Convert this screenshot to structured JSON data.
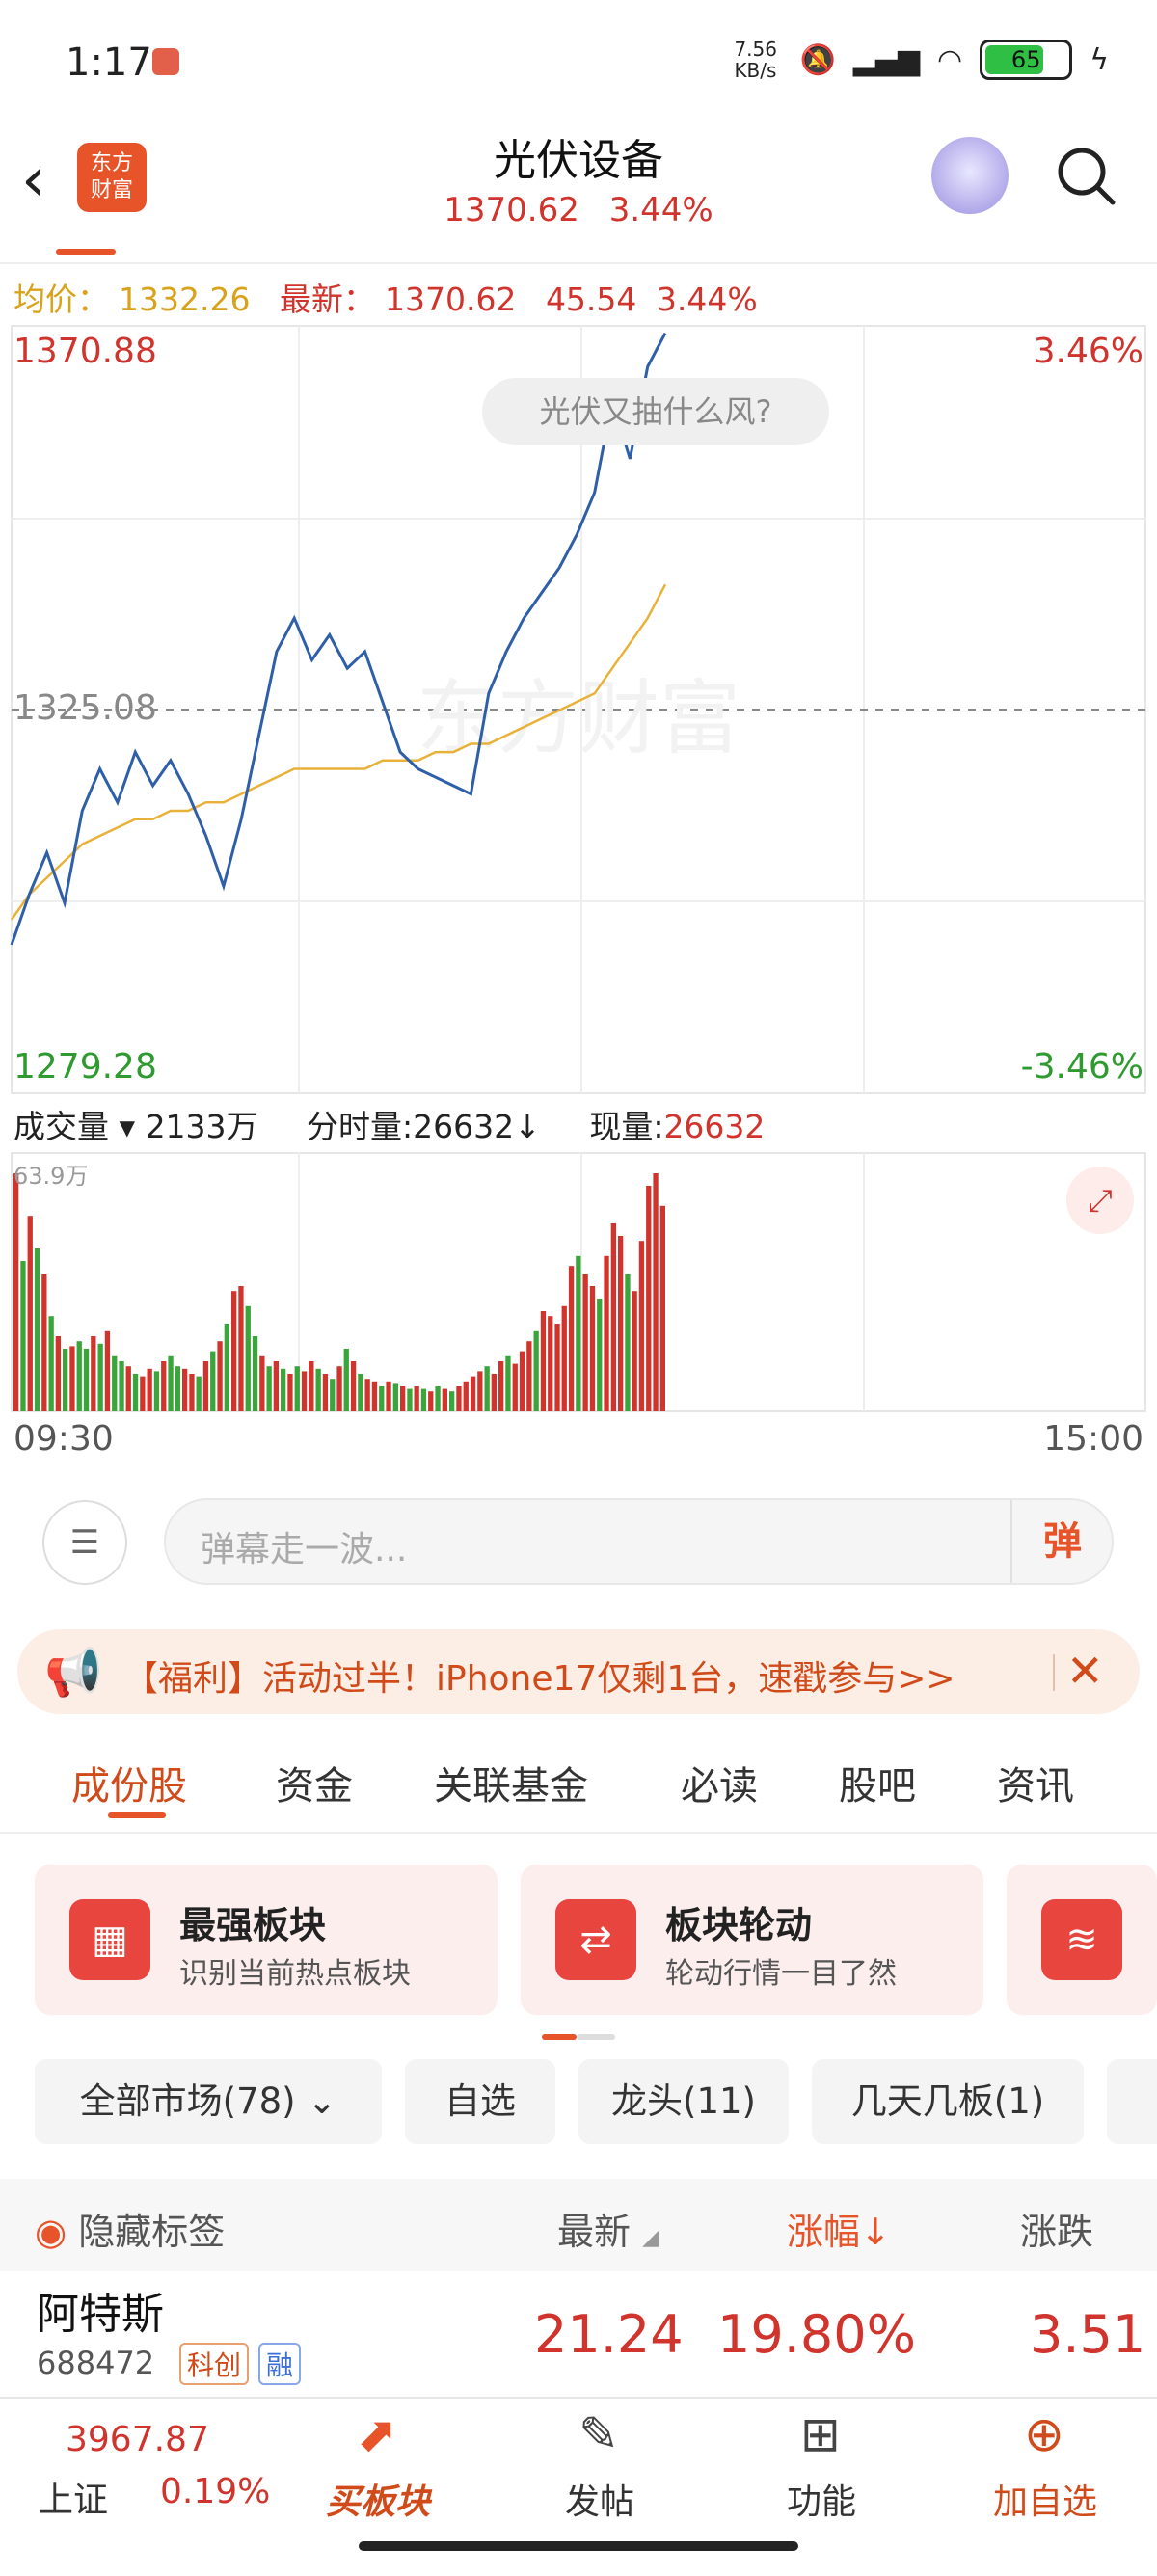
{
  "status_bar": {
    "time": "1:17",
    "net_speed": "7.56 KB/s",
    "battery": "65",
    "icons": [
      "notification-icon",
      "mute-icon",
      "signal-icon",
      "wifi-icon",
      "battery-icon",
      "charging-icon"
    ]
  },
  "header": {
    "logo": "东方财富",
    "title": "光伏设备",
    "price": "1370.62",
    "change_pct": "3.44%"
  },
  "info_line": {
    "avg_label": "均价：",
    "avg_value": "1332.26",
    "latest_label": "最新：",
    "latest_value": "1370.62",
    "change": "45.54",
    "change_pct": "3.44%"
  },
  "chart": {
    "high_label": "1370.88",
    "high_pct": "3.46%",
    "mid_label": "1325.08",
    "low_label": "1279.28",
    "low_pct": "-3.46%",
    "question_bubble": "光伏又抽什么风?",
    "watermark": "东方财富",
    "time_start": "09:30",
    "time_end": "15:00"
  },
  "chart_data": {
    "type": "line",
    "ylim": [
      1279.28,
      1370.88
    ],
    "reference": 1325.08,
    "series": [
      {
        "values": [
          1297,
          1303,
          1308,
          1302,
          1313,
          1318,
          1314,
          1320,
          1316,
          1319,
          1315,
          1310,
          1304,
          1312,
          1322,
          1332,
          1336,
          1331,
          1334,
          1330,
          1332,
          1326,
          1320,
          1318,
          1317,
          1316,
          1315,
          1327,
          1332,
          1336,
          1339,
          1342,
          1346,
          1351,
          1362,
          1355,
          1366,
          1370
        ]
      },
      {
        "values": [
          1300,
          1303,
          1305,
          1307,
          1309,
          1310,
          1311,
          1312,
          1312,
          1313,
          1313,
          1314,
          1314,
          1315,
          1316,
          1317,
          1318,
          1318,
          1318,
          1318,
          1318,
          1319,
          1319,
          1319,
          1320,
          1320,
          1321,
          1321,
          1322,
          1323,
          1324,
          1325,
          1326,
          1327,
          1330,
          1333,
          1336,
          1340
        ]
      }
    ]
  },
  "volume": {
    "label": "成交量",
    "total": "2133万",
    "time_share_label": "分时量:",
    "time_share_value": "26632↓",
    "current_label": "现量:",
    "current_value": "26632",
    "max_label": "63.9万",
    "bars": [
      0.95,
      0.6,
      0.78,
      0.65,
      0.55,
      0.38,
      0.3,
      0.25,
      0.26,
      0.28,
      0.25,
      0.3,
      0.27,
      0.32,
      0.22,
      0.2,
      0.18,
      0.15,
      0.14,
      0.17,
      0.16,
      0.2,
      0.22,
      0.18,
      0.17,
      0.15,
      0.14,
      0.2,
      0.24,
      0.28,
      0.35,
      0.48,
      0.5,
      0.42,
      0.3,
      0.22,
      0.18,
      0.2,
      0.17,
      0.15,
      0.18,
      0.16,
      0.2,
      0.17,
      0.15,
      0.13,
      0.18,
      0.25,
      0.2,
      0.15,
      0.13,
      0.12,
      0.1,
      0.12,
      0.11,
      0.1,
      0.09,
      0.1,
      0.09,
      0.08,
      0.1,
      0.09,
      0.08,
      0.1,
      0.12,
      0.14,
      0.16,
      0.18,
      0.15,
      0.2,
      0.22,
      0.19,
      0.24,
      0.28,
      0.32,
      0.4,
      0.38,
      0.35,
      0.42,
      0.58,
      0.62,
      0.55,
      0.5,
      0.45,
      0.62,
      0.75,
      0.7,
      0.55,
      0.48,
      0.68,
      0.9,
      0.95,
      0.82
    ],
    "bar_colors": [
      "r",
      "g",
      "r",
      "g",
      "r",
      "g",
      "r",
      "g",
      "r",
      "g",
      "g",
      "r",
      "g",
      "r",
      "g",
      "g",
      "r",
      "g",
      "r",
      "r",
      "g",
      "r",
      "g",
      "g",
      "r",
      "r",
      "g",
      "r",
      "g",
      "r",
      "g",
      "r",
      "r",
      "g",
      "g",
      "r",
      "g",
      "r",
      "g",
      "r",
      "g",
      "r",
      "r",
      "g",
      "r",
      "g",
      "r",
      "g",
      "r",
      "g",
      "r",
      "r",
      "g",
      "r",
      "g",
      "r",
      "g",
      "r",
      "g",
      "r",
      "g",
      "r",
      "g",
      "r",
      "r",
      "r",
      "r",
      "g",
      "r",
      "r",
      "g",
      "r",
      "r",
      "r",
      "g",
      "r",
      "r",
      "r",
      "r",
      "r",
      "g",
      "r",
      "r",
      "g",
      "r",
      "r",
      "r",
      "g",
      "r",
      "r",
      "r",
      "r",
      "r"
    ]
  },
  "danmaku": {
    "placeholder": "弹幕走一波...",
    "button": "弹"
  },
  "banner": {
    "text": "【福利】活动过半！iPhone17仅剩1台，速戳参与>>"
  },
  "tabs": [
    "成份股",
    "资金",
    "关联基金",
    "必读",
    "股吧",
    "资讯"
  ],
  "cards": [
    {
      "title": "最强板块",
      "subtitle": "识别当前热点板块"
    },
    {
      "title": "板块轮动",
      "subtitle": "轮动行情一目了然"
    }
  ],
  "filters": [
    "全部市场(78)",
    "自选",
    "龙头(11)",
    "几天几板(1)"
  ],
  "table": {
    "hide_label": "隐藏标签",
    "col_latest": "最新",
    "col_change_pct": "涨幅↓",
    "col_change": "涨跌",
    "rows": [
      {
        "name": "阿特斯",
        "code": "688472",
        "tag1": "科创",
        "tag2": "融",
        "latest": "21.24",
        "change_pct": "19.80%",
        "change": "3.51"
      }
    ]
  },
  "bottom_nav": {
    "index_value": "3967.87",
    "index_name": "上证",
    "index_pct": "0.19%",
    "items": [
      {
        "label": "买板块"
      },
      {
        "label": "发帖"
      },
      {
        "label": "功能"
      },
      {
        "label": "加自选"
      }
    ]
  }
}
